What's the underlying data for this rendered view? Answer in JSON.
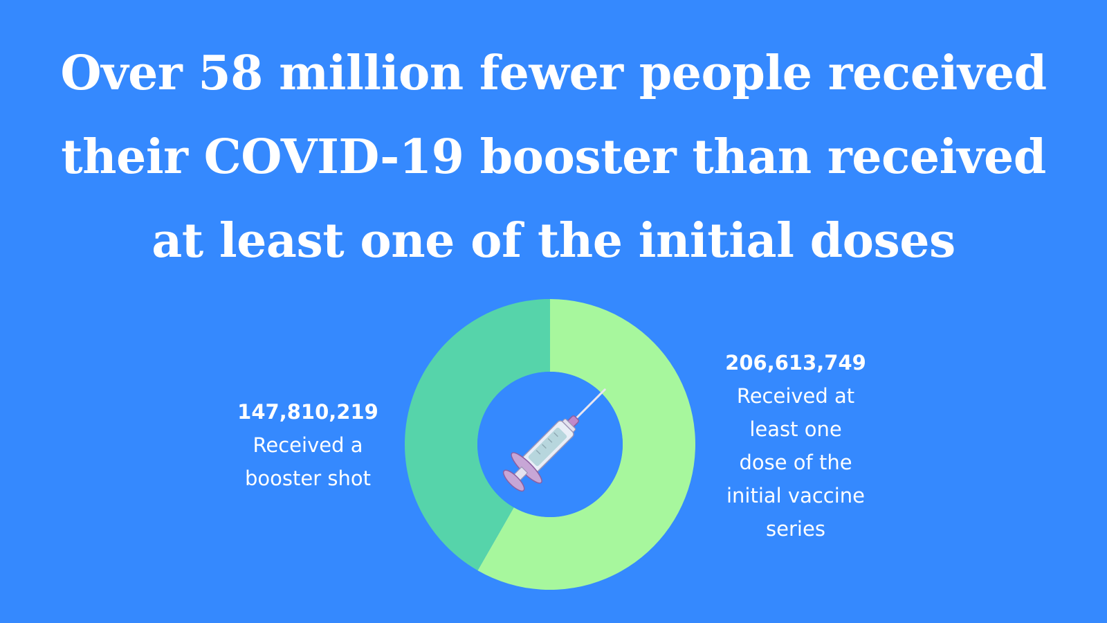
{
  "title_lines": [
    "Over 58 million fewer people received",
    "their COVID-19 booster than received",
    "at least one of the initial doses"
  ],
  "icon": "syringe-icon",
  "colors": {
    "background": "#3589fe",
    "booster": "#56d4aa",
    "initial": "#a7f79d",
    "text": "#ffffff"
  },
  "chart_data": {
    "type": "pie",
    "donut": true,
    "title": "",
    "slices": [
      {
        "value": 206613749,
        "value_label": "206,613,749",
        "desc_lines": [
          "Received at",
          "least one",
          "dose of the",
          "initial vaccine",
          "series"
        ],
        "color": "#a7f79d"
      },
      {
        "value": 147810219,
        "value_label": "147,810,219",
        "desc_lines": [
          "Received a",
          "booster shot"
        ],
        "color": "#56d4aa"
      }
    ]
  }
}
